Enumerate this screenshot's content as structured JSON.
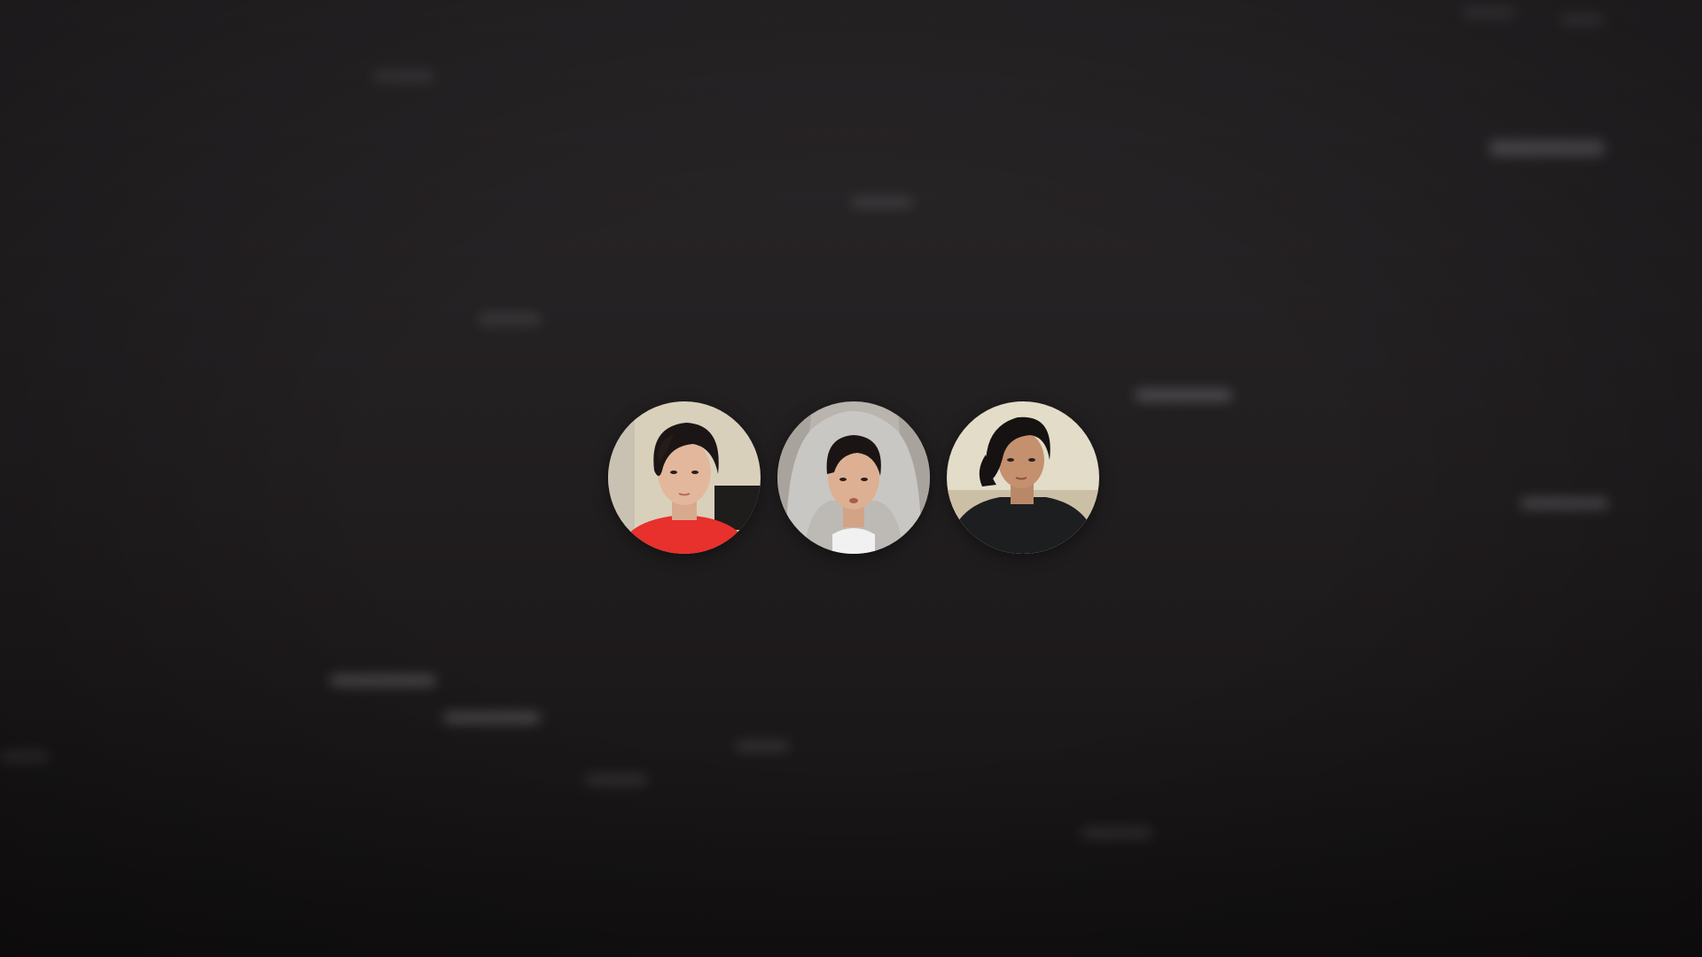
{
  "screen": {
    "background_top": "#2a2729",
    "background_bottom": "#131112"
  },
  "participants": [
    {
      "icon": "participant-avatar",
      "shirt_color": "#e8302c",
      "backdrop_color": "#d9d0bc"
    },
    {
      "icon": "participant-avatar",
      "shirt_color": "#f1f1f1",
      "hoodie_color": "#c9c7c4",
      "backdrop_color": "#b9b4ae"
    },
    {
      "icon": "participant-avatar",
      "shirt_color": "#1d1e20",
      "backdrop_color": "#e3dcc8"
    }
  ]
}
